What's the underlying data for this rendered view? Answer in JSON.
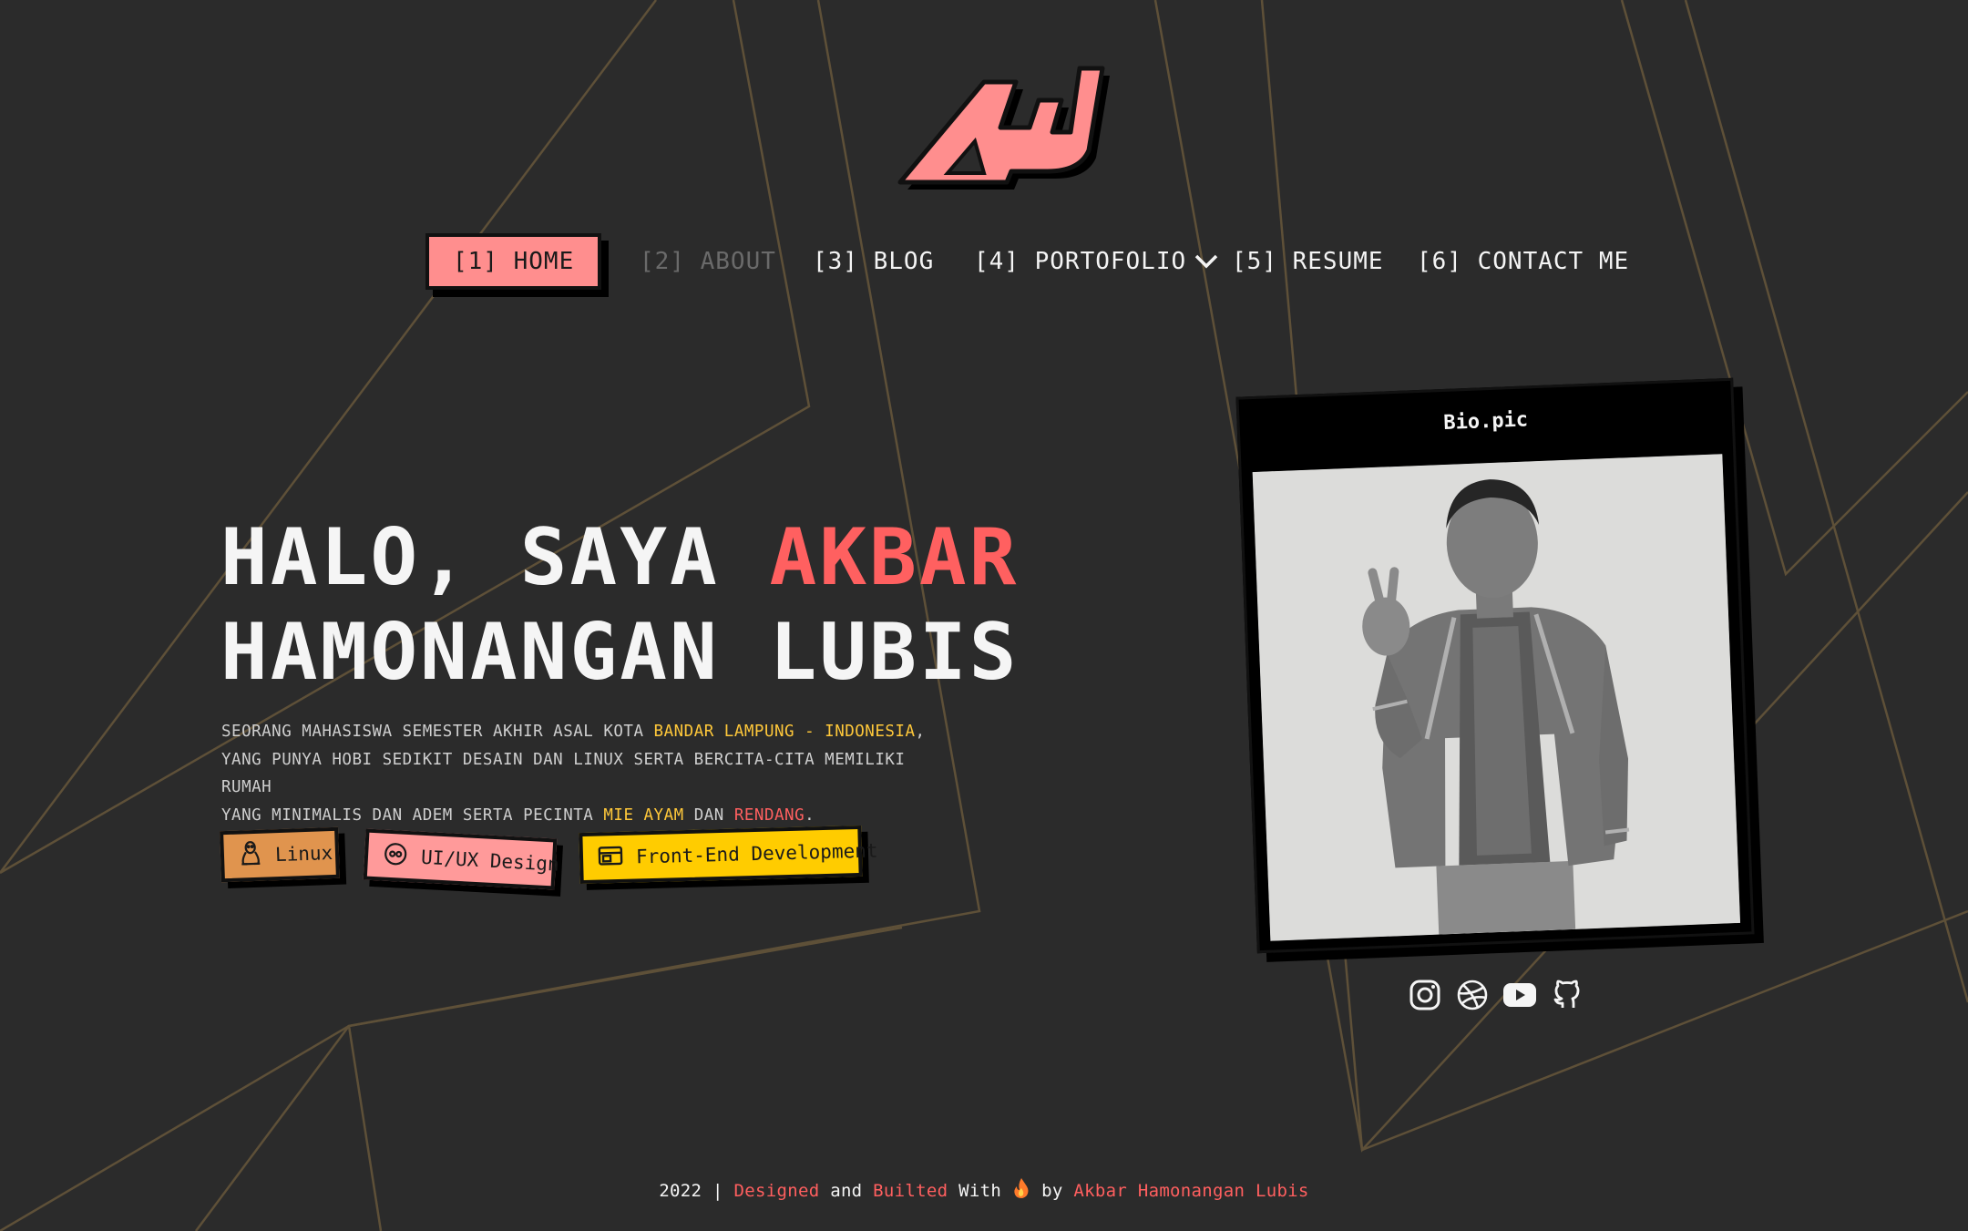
{
  "logo": {
    "alt": "AHL logo",
    "fill": "#ff8e8e"
  },
  "nav": {
    "items": [
      {
        "label": "[1] HOME",
        "state": "active"
      },
      {
        "label": "[2] ABOUT",
        "state": "disabled"
      },
      {
        "label": "[3] BLOG",
        "state": "normal"
      },
      {
        "label": "[4] PORTOFOLIO",
        "state": "normal",
        "icon": "chevron-down-icon"
      },
      {
        "label": "[5] RESUME",
        "state": "normal"
      },
      {
        "label": "[6] CONTACT ME",
        "state": "normal"
      }
    ]
  },
  "hero": {
    "title_part1": "HALO, SAYA ",
    "title_accent": "AKBAR",
    "title_line2": "HAMONANGAN LUBIS",
    "desc": {
      "l1_a": "SEORANG MAHASISWA SEMESTER AKHIR ASAL KOTA ",
      "l1_hl": "BANDAR LAMPUNG - INDONESIA",
      "l1_b": ",",
      "l2": "YANG PUNYA HOBI SEDIKIT DESAIN DAN LINUX SERTA BERCITA-CITA MEMILIKI RUMAH",
      "l3_a": "YANG MINIMALIS DAN ADEM SERTA PECINTA ",
      "l3_hl1": "MIE AYAM",
      "l3_b": " DAN ",
      "l3_hl2": "RENDANG",
      "l3_c": "."
    },
    "tags": [
      {
        "label": "Linux",
        "icon": "linux-icon",
        "color": "#e0944e"
      },
      {
        "label": "UI/UX Design",
        "icon": "figma-icon",
        "color": "#ff9a9a"
      },
      {
        "label": "Front-End Development",
        "icon": "browser-window-icon",
        "color": "#ffcc00"
      }
    ]
  },
  "bio": {
    "title": "Bio.pic",
    "photo_alt": "Photo of Akbar Hamonangan Lubis making a peace sign"
  },
  "social": [
    {
      "name": "instagram-icon"
    },
    {
      "name": "dribbble-icon"
    },
    {
      "name": "youtube-icon"
    },
    {
      "name": "github-icon"
    }
  ],
  "footer": {
    "year": "2022",
    "sep": "|",
    "designed": "Designed",
    "and": "and",
    "builted": "Builted",
    "with": "With",
    "by": "by",
    "author": "Akbar Hamonangan Lubis"
  },
  "colors": {
    "background": "#2b2b2b",
    "accent_pink": "#ff8e8e",
    "accent_red": "#ff6060",
    "accent_yellow": "#ffc83a",
    "accent_orange": "#e0944e",
    "lines": "#6b5a3a"
  }
}
